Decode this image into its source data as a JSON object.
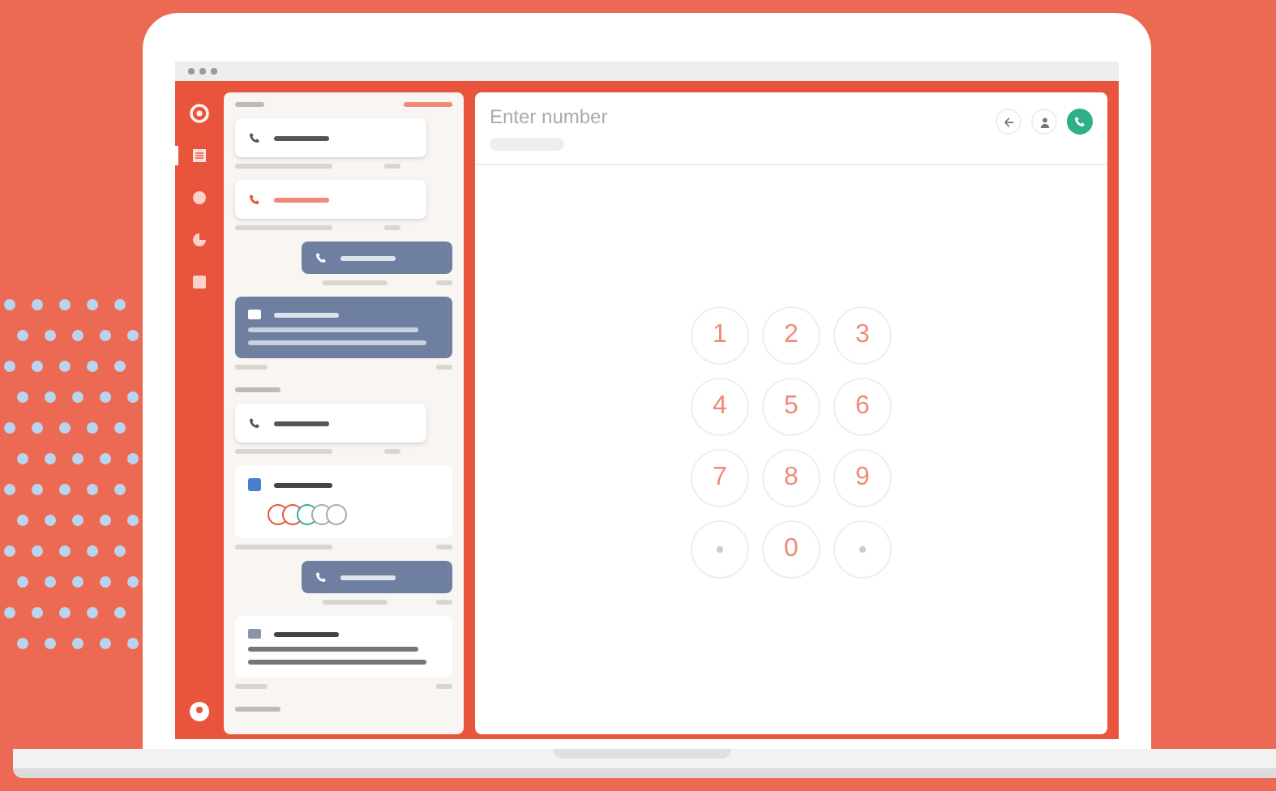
{
  "nav": [
    {
      "kind": "logo",
      "selected": false
    },
    {
      "kind": "list",
      "selected": true
    },
    {
      "kind": "circle",
      "selected": false
    },
    {
      "kind": "pie",
      "selected": false
    },
    {
      "kind": "card",
      "selected": false
    }
  ],
  "feed": [
    {
      "kind": "call",
      "missed": false
    },
    {
      "kind": "call",
      "missed": true
    },
    {
      "kind": "bubble"
    },
    {
      "kind": "message"
    },
    {
      "kind": "section"
    },
    {
      "kind": "call",
      "missed": false
    },
    {
      "kind": "group"
    },
    {
      "kind": "bubble"
    },
    {
      "kind": "note"
    },
    {
      "kind": "section"
    }
  ],
  "dialer": {
    "placeholder": "Enter number",
    "keys": [
      {
        "kind": "digit",
        "label": "1"
      },
      {
        "kind": "digit",
        "label": "2"
      },
      {
        "kind": "digit",
        "label": "3"
      },
      {
        "kind": "digit",
        "label": "4"
      },
      {
        "kind": "digit",
        "label": "5"
      },
      {
        "kind": "digit",
        "label": "6"
      },
      {
        "kind": "digit",
        "label": "7"
      },
      {
        "kind": "digit",
        "label": "8"
      },
      {
        "kind": "digit",
        "label": "9"
      },
      {
        "kind": "symbol"
      },
      {
        "kind": "digit",
        "label": "0"
      },
      {
        "kind": "symbol"
      }
    ]
  }
}
